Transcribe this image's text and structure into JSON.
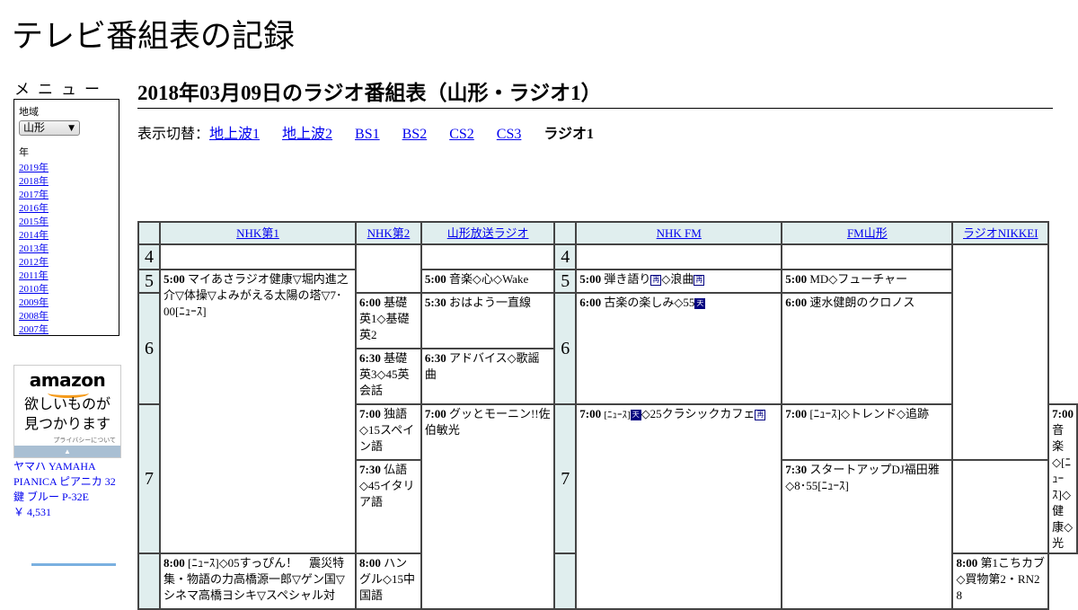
{
  "site": {
    "title": "テレビ番組表の記録"
  },
  "menu": {
    "title": "メニュー",
    "region_label": "地域",
    "region_value": "山形",
    "year_label": "年",
    "years": [
      "2019年",
      "2018年",
      "2017年",
      "2016年",
      "2015年",
      "2014年",
      "2013年",
      "2012年",
      "2011年",
      "2010年",
      "2009年",
      "2008年",
      "2007年"
    ]
  },
  "ad": {
    "logo": "amazon",
    "line1": "欲しいものが",
    "line2": "見つかります",
    "privacy": "プライバシーについて",
    "product_line1": "ヤマハ YAMAHA",
    "product_line2": "PIANICA ピアニカ 32",
    "product_line3": "鍵 ブルー P-32E",
    "price": "￥ 4,531"
  },
  "page": {
    "heading": "2018年03月09日のラジオ番組表（山形・ラジオ1）",
    "switch_label": "表示切替：",
    "switch_links": [
      "地上波1",
      "地上波2",
      "BS1",
      "BS2",
      "CS2",
      "CS3"
    ],
    "switch_current": "ラジオ1"
  },
  "schedule": {
    "stations_left": [
      "NHK第1",
      "NHK第2",
      "山形放送ラジオ"
    ],
    "stations_right": [
      "NHK FM",
      "FM山形",
      "ラジオNIKKEI"
    ],
    "hours": [
      "4",
      "5",
      "6",
      "7"
    ],
    "nhk1": [
      {
        "time": "5:00",
        "title": "マイあさラジオ健康▽堀内進之介▽体操▽よみがえる太陽の塔▽7･00[ﾆｭｰｽ]"
      },
      {
        "time": "8:00",
        "title": "[ﾆｭｰｽ]◇05すっぴん！　震災特集・物語の力高橋源一郎▽ゲン国▽シネマ高橋ヨシキ▽スペシャル対"
      }
    ],
    "nhk2": [
      {
        "time": "6:00",
        "title": "基礎英1◇基礎英2"
      },
      {
        "time": "6:30",
        "title": "基礎英3◇45英会話"
      },
      {
        "time": "7:00",
        "title": "独語◇15スペイン語"
      },
      {
        "time": "7:30",
        "title": "仏語◇45イタリア語"
      },
      {
        "time": "8:00",
        "title": "ハングル◇15中国語"
      }
    ],
    "ybc": [
      {
        "time": "5:00",
        "title": "音楽◇心◇Wake"
      },
      {
        "time": "5:30",
        "title": "おはよう一直線"
      },
      {
        "time": "6:30",
        "title": "アドバイス◇歌謡曲"
      },
      {
        "time": "7:00",
        "title": "グッとモーニン!!佐伯敏光"
      }
    ],
    "nhkfm": [
      {
        "time": "5:00",
        "title_a": "弾き語り",
        "title_b": "◇浪曲"
      },
      {
        "time": "6:00",
        "title": "古楽の楽しみ◇55"
      },
      {
        "time": "7:00",
        "title_a": "[ﾆｭｰｽ]",
        "title_b": "◇25クラシックカフェ"
      }
    ],
    "fmy": [
      {
        "time": "5:00",
        "title": "MD◇フューチャー"
      },
      {
        "time": "6:00",
        "title": "速水健朗のクロノス"
      },
      {
        "time": "7:00",
        "title": "[ﾆｭｰｽ]◇トレンド◇追跡"
      },
      {
        "time": "7:30",
        "title": "スタートアップDJ福田雅◇8･55[ﾆｭｰｽ]"
      }
    ],
    "nikkei": [
      {
        "time": "7:00",
        "title": "音楽◇[ﾆｭｰｽ]◇健康◇光"
      },
      {
        "time": "8:00",
        "title": "第1こちカブ◇買物第2・RN2　8"
      }
    ],
    "icons": {
      "rerun": "再",
      "weather": "天"
    }
  }
}
